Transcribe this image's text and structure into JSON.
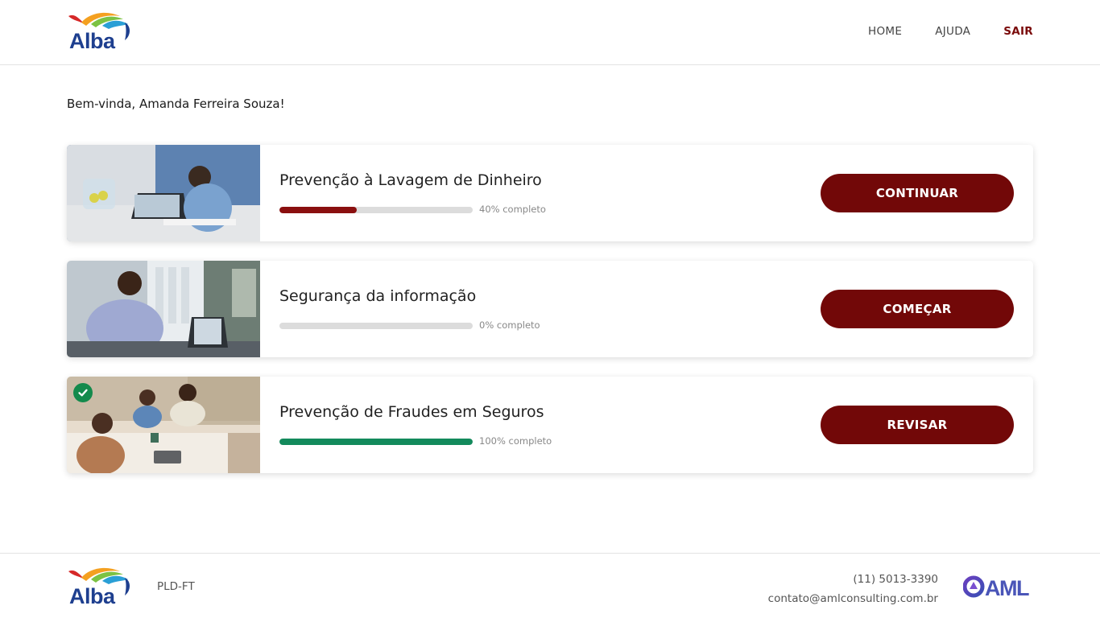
{
  "header": {
    "logo_text": "Alba",
    "nav": [
      {
        "label": "HOME"
      },
      {
        "label": "AJUDA"
      },
      {
        "label": "SAIR"
      }
    ]
  },
  "welcome": "Bem-vinda, Amanda Ferreira Souza!",
  "courses": [
    {
      "title": "Prevenção à Lavagem de Dinheiro",
      "progress": 40,
      "progress_label": "40% completo",
      "button": "CONTINUAR",
      "bar_color": "#8a0f0f",
      "completed": false
    },
    {
      "title": "Segurança da informação",
      "progress": 0,
      "progress_label": "0% completo",
      "button": "COMEÇAR",
      "bar_color": "#8a0f0f",
      "completed": false
    },
    {
      "title": "Prevenção de Fraudes em Seguros",
      "progress": 100,
      "progress_label": "100% completo",
      "button": "REVISAR",
      "bar_color": "#138a5c",
      "completed": true
    }
  ],
  "footer": {
    "logo_text": "Alba",
    "label": "PLD-FT",
    "phone": "(11) 5013-3390",
    "email": "contato@amlconsulting.com.br",
    "partner_logo_text": "AML"
  },
  "colors": {
    "brand": "#720808",
    "success": "#138a4c"
  },
  "icons": {
    "check": "check-circle-icon"
  }
}
